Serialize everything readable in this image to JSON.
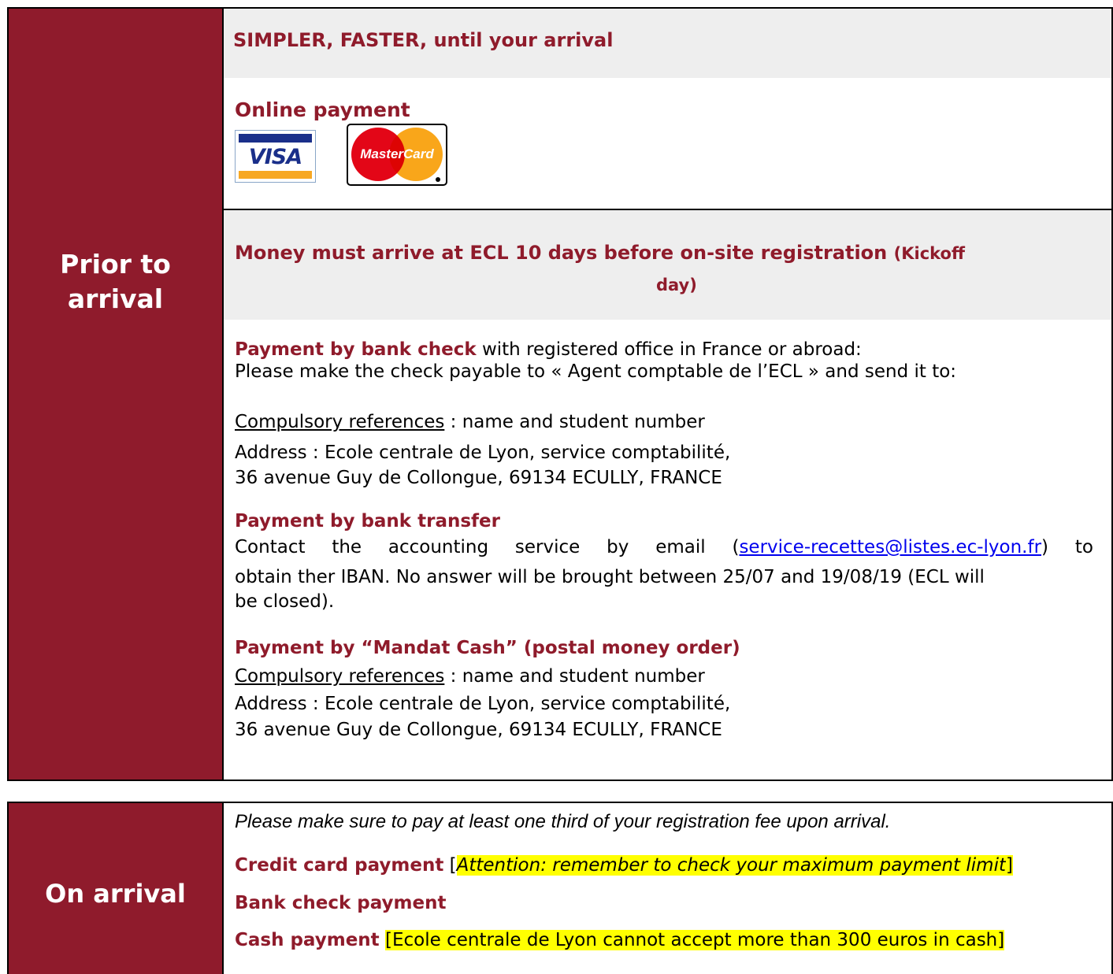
{
  "prior": {
    "label": "Prior to arrival",
    "header": "SIMPLER, FASTER, until your  arrival",
    "online_title": "Online payment",
    "visa_text": "VISA",
    "mastercard_text": "MasterCard",
    "deadline_main": "Money must arrive at ECL 10 days before on-site registration",
    "deadline_paren_line1": "(Kickoff",
    "deadline_paren_line2": "day)",
    "check_title": "Payment by bank check",
    "check_rest": " with registered office in France or abroad:",
    "check_line2": "Please make the check payable to « Agent comptable de l’ECL » and send it to:",
    "refs_label": "Compulsory references",
    "refs_rest": "  : name and student number",
    "address_line1": "Address : Ecole centrale de Lyon, service comptabilité,",
    "address_line2": "36 avenue Guy de Collongue, 69134 ECULLY, FRANCE",
    "transfer_title": "Payment by bank transfer",
    "transfer_pre": "Contact the accounting service by email (",
    "transfer_email": "service-recettes@listes.ec-lyon.fr",
    "transfer_post": ") to",
    "transfer_line2": "obtain ther IBAN. No answer will be brought between 25/07 and 19/08/19 (ECL will",
    "transfer_line3": "be closed).",
    "mandat_title": "Payment by “Mandat Cash” (postal money order)",
    "mandat_refs_label": "Compulsory references",
    "mandat_refs_rest": "  : name and student number",
    "mandat_address_line1": "Address : Ecole centrale de Lyon, service comptabilité,",
    "mandat_address_line2": "36 avenue Guy de Collongue, 69134 ECULLY, FRANCE"
  },
  "on": {
    "label": "On arrival",
    "intro": "Please make sure to pay at least one third of your registration fee upon arrival.",
    "credit_title": "Credit card payment",
    "credit_open": "[",
    "credit_note": "Attention: remember to check your maximum payment limit",
    "credit_close": "]",
    "check_title": "Bank check payment",
    "cash_title": "Cash payment",
    "cash_note": "[Ecole centrale de Lyon cannot accept more than 300 euros in cash]"
  },
  "colors": {
    "maroon": "#8f1b2b",
    "band": "#eeeeee",
    "highlight": "#ffff00"
  }
}
